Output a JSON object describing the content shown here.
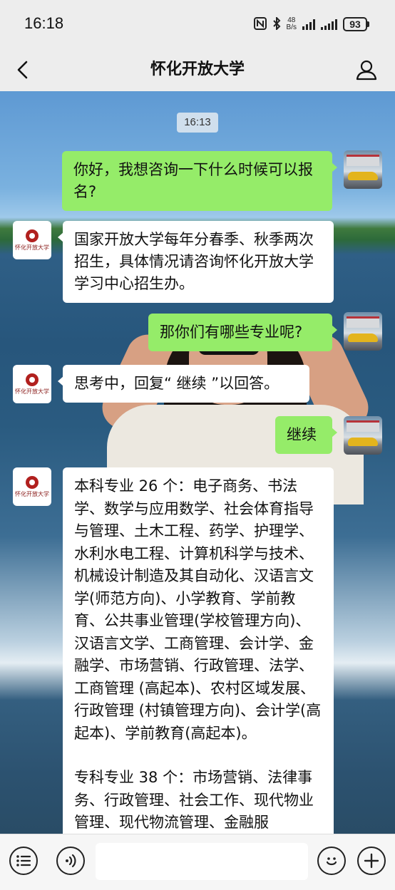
{
  "status_bar": {
    "time": "16:18",
    "net_speed_value": "48",
    "net_speed_unit": "B/s",
    "battery": "93"
  },
  "header": {
    "title": "怀化开放大学"
  },
  "chat": {
    "timestamp": "16:13",
    "messages": [
      {
        "sender": "me",
        "text": "你好，我想咨询一下什么时候可以报名?"
      },
      {
        "sender": "them",
        "text": "国家开放大学每年分春季、秋季两次招生，具体情况请咨询怀化开放大学学习中心招生办。"
      },
      {
        "sender": "me",
        "text": "那你们有哪些专业呢?"
      },
      {
        "sender": "them",
        "text": "思考中，回复“ 继续 ”以回答。"
      },
      {
        "sender": "me",
        "text": "继续"
      },
      {
        "sender": "them",
        "paragraphs": [
          "本科专业 26 个：电子商务、书法学、数学与应用数学、社会体育指导与管理、土木工程、药学、护理学、水利水电工程、计算机科学与技术、机械设计制造及其自动化、汉语言文学(师范方向)、小学教育、学前教育、公共事业管理(学校管理方向)、汉语言文学、工商管理、会计学、金融学、市场营销、行政管理、法学、工商管理 (高起本)、农村区域发展、行政管理 (村镇管理方向)、会计学(高起本)、学前教育(高起本)。",
          "专科专业 38 个：市场营销、法律事务、行政管理、社会工作、现代物业管理、现代物流管理、金融服"
        ]
      }
    ],
    "university_avatar_text": "怀化开放大学"
  },
  "icons": {
    "back": "chevron-left-icon",
    "profile": "person-icon",
    "menu": "list-icon",
    "voice": "voice-icon",
    "emoji": "smiley-icon",
    "add": "plus-icon"
  },
  "colors": {
    "my_bubble": "#95ec69",
    "their_bubble": "#ffffff",
    "bar_bg": "#ededed"
  }
}
